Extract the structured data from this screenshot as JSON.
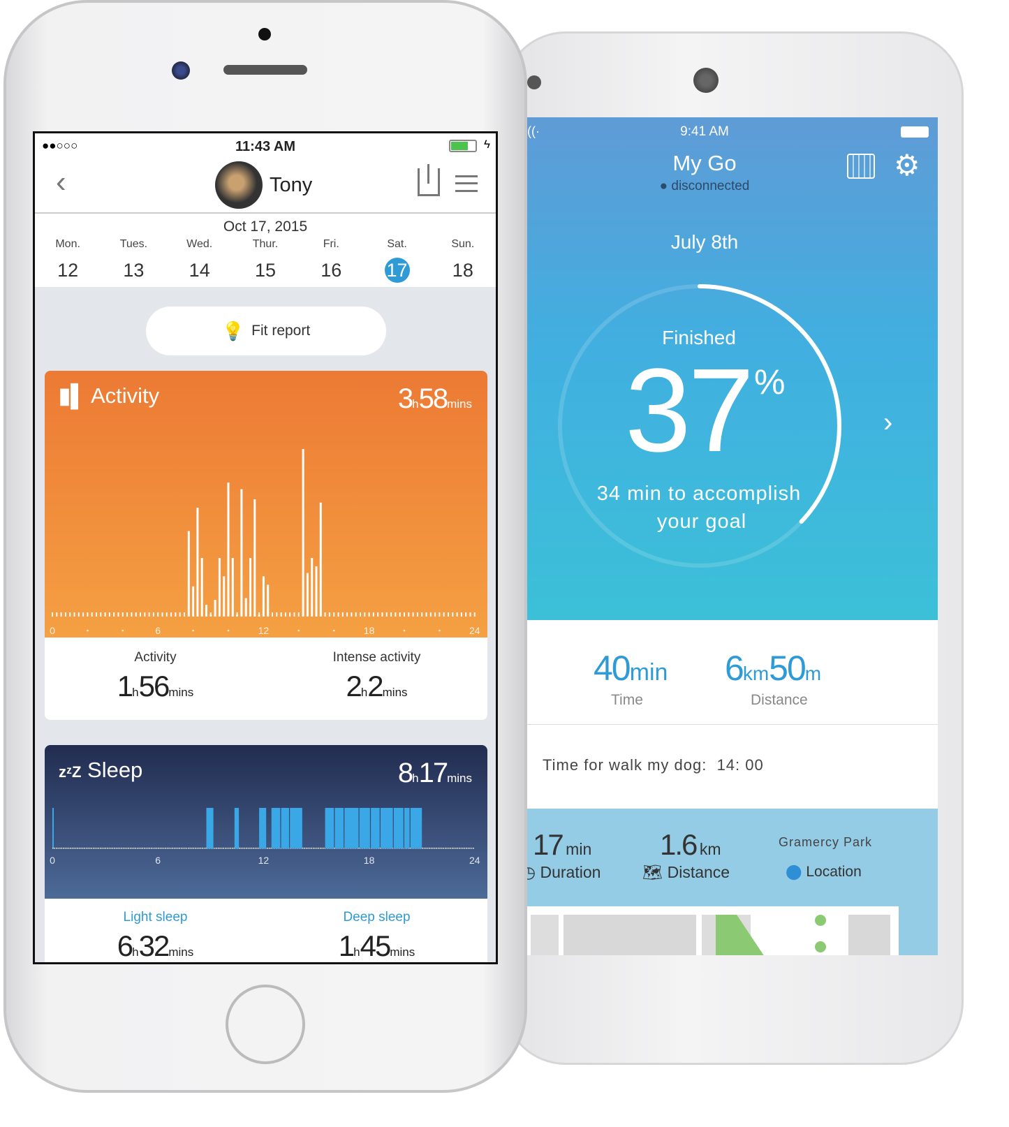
{
  "left_phone": {
    "status": {
      "signal": "●●○○○",
      "time": "11:43 AM",
      "battery_color": "#4cc34c"
    },
    "header": {
      "name": "Tony",
      "back_icon": "chevron-left-icon",
      "share_icon": "share-icon",
      "menu_icon": "hamburger-menu-icon"
    },
    "date": "Oct 17, 2015",
    "week": [
      {
        "day": "Mon.",
        "num": "12"
      },
      {
        "day": "Tues.",
        "num": "13"
      },
      {
        "day": "Wed.",
        "num": "14"
      },
      {
        "day": "Thur.",
        "num": "15"
      },
      {
        "day": "Fri.",
        "num": "16"
      },
      {
        "day": "Sat.",
        "num": "17",
        "selected": true
      },
      {
        "day": "Sun.",
        "num": "18"
      }
    ],
    "fit_report": "Fit report",
    "activity": {
      "title": "Activity",
      "total_h": "3",
      "total_m": "58",
      "h_unit": "h",
      "m_unit": "mins",
      "color_top": "#ec7a34",
      "color_bottom": "#f5a043",
      "stats": [
        {
          "label": "Activity",
          "h": "1",
          "m": "56"
        },
        {
          "label": "Intense activity",
          "h": "2",
          "m": "2"
        }
      ]
    },
    "sleep": {
      "title": "Sleep",
      "total_h": "8",
      "total_m": "17",
      "h_unit": "h",
      "m_unit": "mins",
      "color": "#3aa8e6",
      "stats": [
        {
          "label": "Light sleep",
          "h": "6",
          "m": "32"
        },
        {
          "label": "Deep sleep",
          "h": "1",
          "m": "45"
        }
      ]
    }
  },
  "right_phone": {
    "status": {
      "time": "9:41 AM"
    },
    "title": "My Go",
    "connection": "disconnected",
    "calendar_icon": "calendar-icon",
    "settings_icon": "gear-icon",
    "date": "July 8th",
    "finished_label": "Finished",
    "percent": 37,
    "percent_text": "37",
    "percent_sign": "%",
    "remaining": "34 min to accomplish",
    "remaining2": "your goal",
    "summary": [
      {
        "value": "40",
        "unit": "min",
        "label": "Time"
      },
      {
        "value": "6",
        "unit": "km",
        "value2": "50",
        "unit2": "m",
        "label": "Distance"
      }
    ],
    "walk_reminder": "Time for walk my dog:  14: 00",
    "walk": {
      "duration": "17",
      "duration_unit": "min",
      "duration_label": "Duration",
      "distance": "1.6",
      "distance_unit": "km",
      "distance_label": "Distance",
      "location_name": "Gramercy Park",
      "location_label": "Location"
    }
  },
  "chart_data": [
    {
      "type": "bar",
      "title": "Activity",
      "x_range": [
        0,
        24
      ],
      "x_ticks": [
        "0",
        "6",
        "12",
        "18",
        "24"
      ],
      "bars": [
        {
          "hour": 7.75,
          "value": 51
        },
        {
          "hour": 8.0,
          "value": 18
        },
        {
          "hour": 8.25,
          "value": 65
        },
        {
          "hour": 8.5,
          "value": 35
        },
        {
          "hour": 8.75,
          "value": 7
        },
        {
          "hour": 9.0,
          "value": 1
        },
        {
          "hour": 9.25,
          "value": 10
        },
        {
          "hour": 9.5,
          "value": 35
        },
        {
          "hour": 9.75,
          "value": 24
        },
        {
          "hour": 10.0,
          "value": 80
        },
        {
          "hour": 10.25,
          "value": 35
        },
        {
          "hour": 10.5,
          "value": 1
        },
        {
          "hour": 10.75,
          "value": 76
        },
        {
          "hour": 11.0,
          "value": 11
        },
        {
          "hour": 11.25,
          "value": 35
        },
        {
          "hour": 11.5,
          "value": 70
        },
        {
          "hour": 11.75,
          "value": 1
        },
        {
          "hour": 12.0,
          "value": 24
        },
        {
          "hour": 12.25,
          "value": 19
        },
        {
          "hour": 14.25,
          "value": 100
        },
        {
          "hour": 14.5,
          "value": 26
        },
        {
          "hour": 14.75,
          "value": 35
        },
        {
          "hour": 15.0,
          "value": 30
        },
        {
          "hour": 15.25,
          "value": 68
        }
      ]
    },
    {
      "type": "bar",
      "title": "Sleep",
      "x_range": [
        0,
        24
      ],
      "x_ticks": [
        "0",
        "6",
        "12",
        "18",
        "24"
      ],
      "segments": [
        [
          8.75,
          9.15
        ],
        [
          10.35,
          10.6
        ],
        [
          11.75,
          12.15
        ],
        [
          12.45,
          12.95
        ],
        [
          13.0,
          13.45
        ],
        [
          13.5,
          14.2
        ],
        [
          15.5,
          16.0
        ],
        [
          16.05,
          16.55
        ],
        [
          16.6,
          17.4
        ],
        [
          17.45,
          18.05
        ],
        [
          18.1,
          18.6
        ],
        [
          18.65,
          19.35
        ],
        [
          19.4,
          19.95
        ],
        [
          20.0,
          20.3
        ],
        [
          20.35,
          21.0
        ]
      ]
    }
  ]
}
